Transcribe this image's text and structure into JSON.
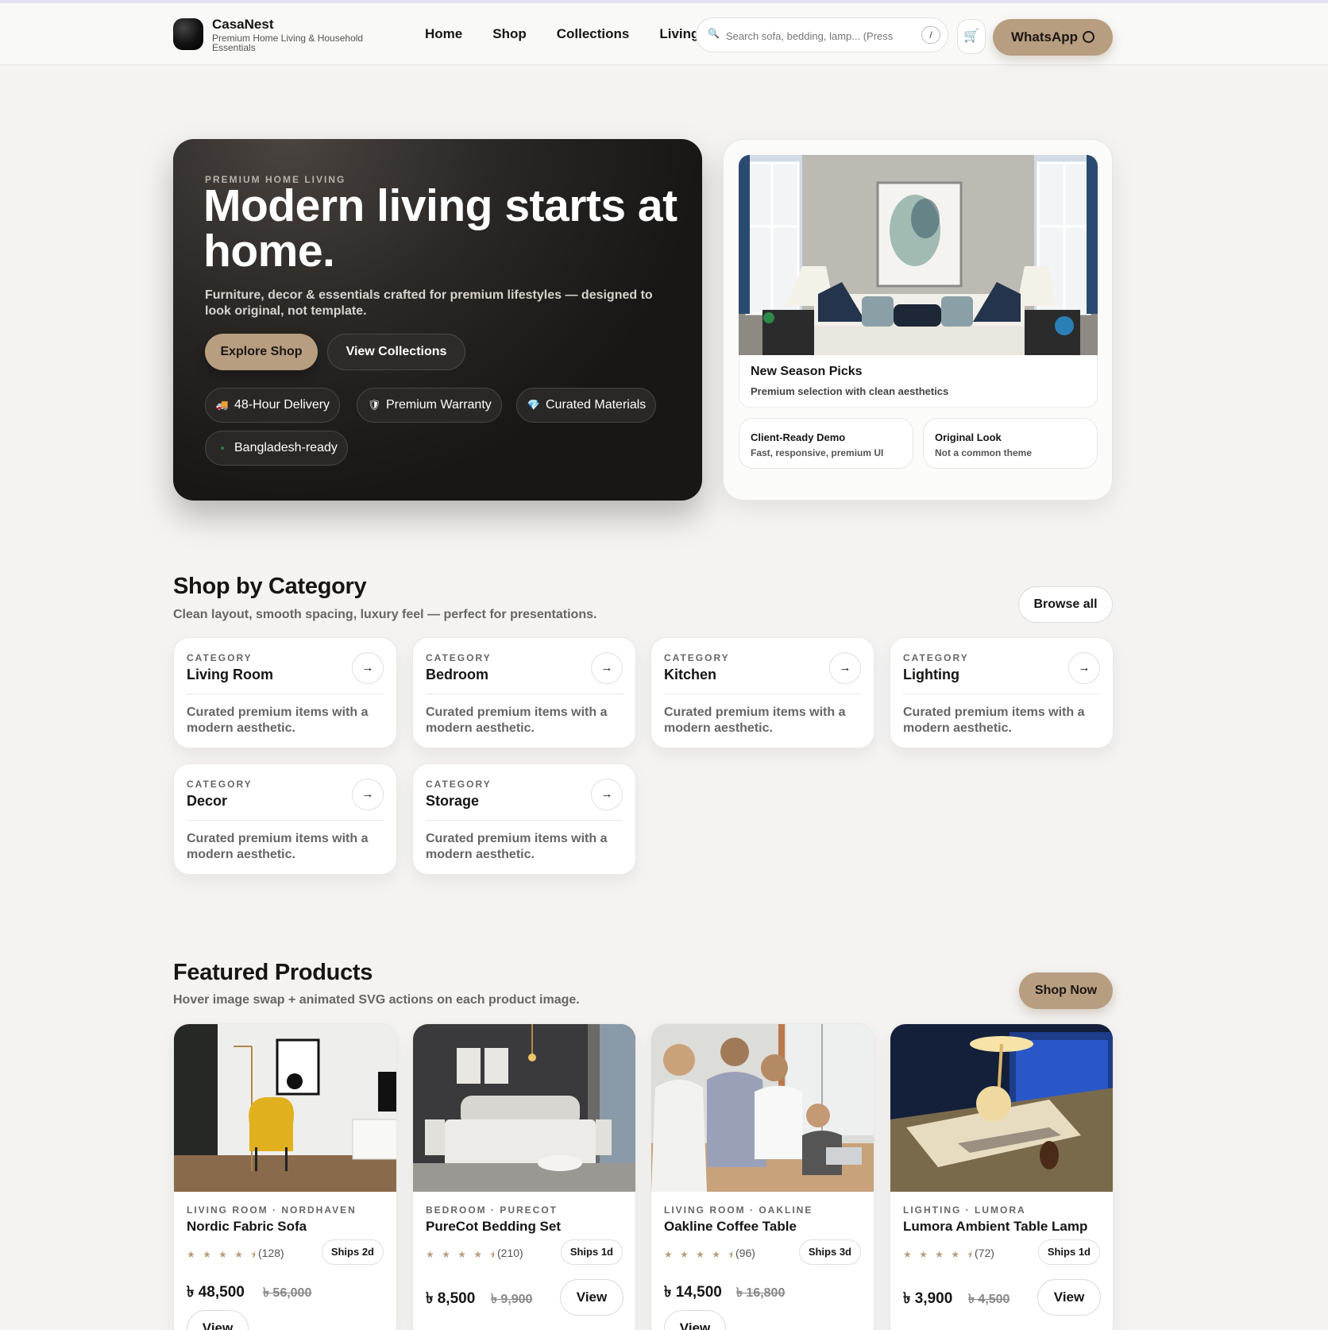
{
  "brand": {
    "name": "CasaNest",
    "tagline": "Premium Home Living & Household Essentials"
  },
  "nav": {
    "items": [
      {
        "label": "Home"
      },
      {
        "label": "Shop"
      },
      {
        "label": "Collections"
      },
      {
        "label": "Living"
      }
    ]
  },
  "search": {
    "placeholder": "Search sofa, bedding, lamp... (Press",
    "shortcut": "/",
    "icon": "search-icon"
  },
  "cart": {
    "icon": "cart-icon"
  },
  "whatsapp": {
    "label": "WhatsApp",
    "icon": "whatsapp-icon"
  },
  "hero": {
    "eyebrow": "PREMIUM HOME LIVING",
    "title": "Modern living starts at home.",
    "subtitle": "Furniture, decor & essentials crafted for premium lifestyles — designed to look original, not template.",
    "primary_cta": "Explore Shop",
    "secondary_cta": "View Collections",
    "chips": [
      {
        "icon": "🚚",
        "label": "48-Hour Delivery"
      },
      {
        "icon": "🛡",
        "label": "Premium Warranty"
      },
      {
        "icon": "💎",
        "label": "Curated Materials"
      },
      {
        "icon": "▪",
        "label": "Bangladesh-ready"
      }
    ]
  },
  "showcase": {
    "title": "New Season Picks",
    "subtitle": "Premium selection with clean aesthetics",
    "mini_cards": [
      {
        "title": "Client-Ready Demo",
        "subtitle": "Fast, responsive, premium UI"
      },
      {
        "title": "Original Look",
        "subtitle": "Not a common theme"
      }
    ]
  },
  "categories": {
    "title": "Shop by Category",
    "subtitle": "Clean layout, smooth spacing, luxury feel — perfect for presentations.",
    "browse_label": "Browse all",
    "items": [
      {
        "eyebrow": "CATEGORY",
        "name": "Living Room",
        "desc": "Curated premium items with a modern aesthetic."
      },
      {
        "eyebrow": "CATEGORY",
        "name": "Bedroom",
        "desc": "Curated premium items with a modern aesthetic."
      },
      {
        "eyebrow": "CATEGORY",
        "name": "Kitchen",
        "desc": "Curated premium items with a modern aesthetic."
      },
      {
        "eyebrow": "CATEGORY",
        "name": "Lighting",
        "desc": "Curated premium items with a modern aesthetic."
      },
      {
        "eyebrow": "CATEGORY",
        "name": "Decor",
        "desc": "Curated premium items with a modern aesthetic."
      },
      {
        "eyebrow": "CATEGORY",
        "name": "Storage",
        "desc": "Curated premium items with a modern aesthetic."
      }
    ]
  },
  "featured": {
    "title": "Featured Products",
    "subtitle": "Hover image swap + animated SVG actions on each product image.",
    "cta_label": "Shop Now",
    "products": [
      {
        "eyebrow": "LIVING ROOM · NORDHAVEN",
        "name": "Nordic Fabric Sofa",
        "stars": "★ ★ ★ ★ ⯨",
        "reviews": "(128)",
        "ship": "Ships 2d",
        "price": "৳ 48,500",
        "old_price": "৳ 56,000",
        "view": "View"
      },
      {
        "eyebrow": "BEDROOM · PURECOT",
        "name": "PureCot Bedding Set",
        "stars": "★ ★ ★ ★ ⯨",
        "reviews": "(210)",
        "ship": "Ships 1d",
        "price": "৳ 8,500",
        "old_price": "৳ 9,900",
        "view": "View"
      },
      {
        "eyebrow": "LIVING ROOM · OAKLINE",
        "name": "Oakline Coffee Table",
        "stars": "★ ★ ★ ★ ⯨",
        "reviews": "(96)",
        "ship": "Ships 3d",
        "price": "৳ 14,500",
        "old_price": "৳ 16,800",
        "view": "View"
      },
      {
        "eyebrow": "LIGHTING · LUMORA",
        "name": "Lumora Ambient Table Lamp",
        "stars": "★ ★ ★ ★ ⯨",
        "reviews": "(72)",
        "ship": "Ships 1d",
        "price": "৳ 3,900",
        "old_price": "৳ 4,500",
        "view": "View"
      }
    ]
  },
  "colors": {
    "accent": "#b89e80",
    "hero_bg": "#181716",
    "page_bg": "#f4f3f1"
  }
}
